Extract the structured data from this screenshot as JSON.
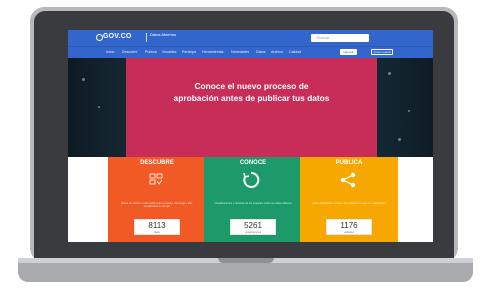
{
  "header": {
    "logo_text": "GOV.CO",
    "brand_text": "Datos Abiertos",
    "search_placeholder": "Buscar",
    "colors": {
      "primary": "#3366cc"
    }
  },
  "nav": {
    "items": [
      "Inicio",
      "Descubre",
      "Publica",
      "Visualiza",
      "Participa",
      "Herramientas",
      "Novedades",
      "Datos",
      "Archivo",
      "Calidad"
    ],
    "login_label": "Ingresar",
    "register_label": "Crear cuenta"
  },
  "hero": {
    "title_line1": "Conoce el nuevo proceso de",
    "title_line2": "aprobación antes de publicar tus datos",
    "slides": 3,
    "active_slide": 2
  },
  "cards": [
    {
      "title": "DESCUBRE",
      "desc": "Datos de interés e información para consulta, descarga y uso, visualizados en tiempo",
      "value": "8113",
      "label": "datos",
      "color": "#f15a24",
      "icon": "grid-icon"
    },
    {
      "title": "CONOCE",
      "desc": "Visualizaciones e historias de los impactos sobre los datos abiertos",
      "value": "5261",
      "label": "visualizaciones",
      "color": "#1c9a6a",
      "icon": "cycle-icon"
    },
    {
      "title": "PUBLICA",
      "desc": "Datos del Estado a través de la plataforma para su reutilización",
      "value": "1176",
      "label": "entidades",
      "color": "#f7a800",
      "icon": "share-icon"
    }
  ]
}
